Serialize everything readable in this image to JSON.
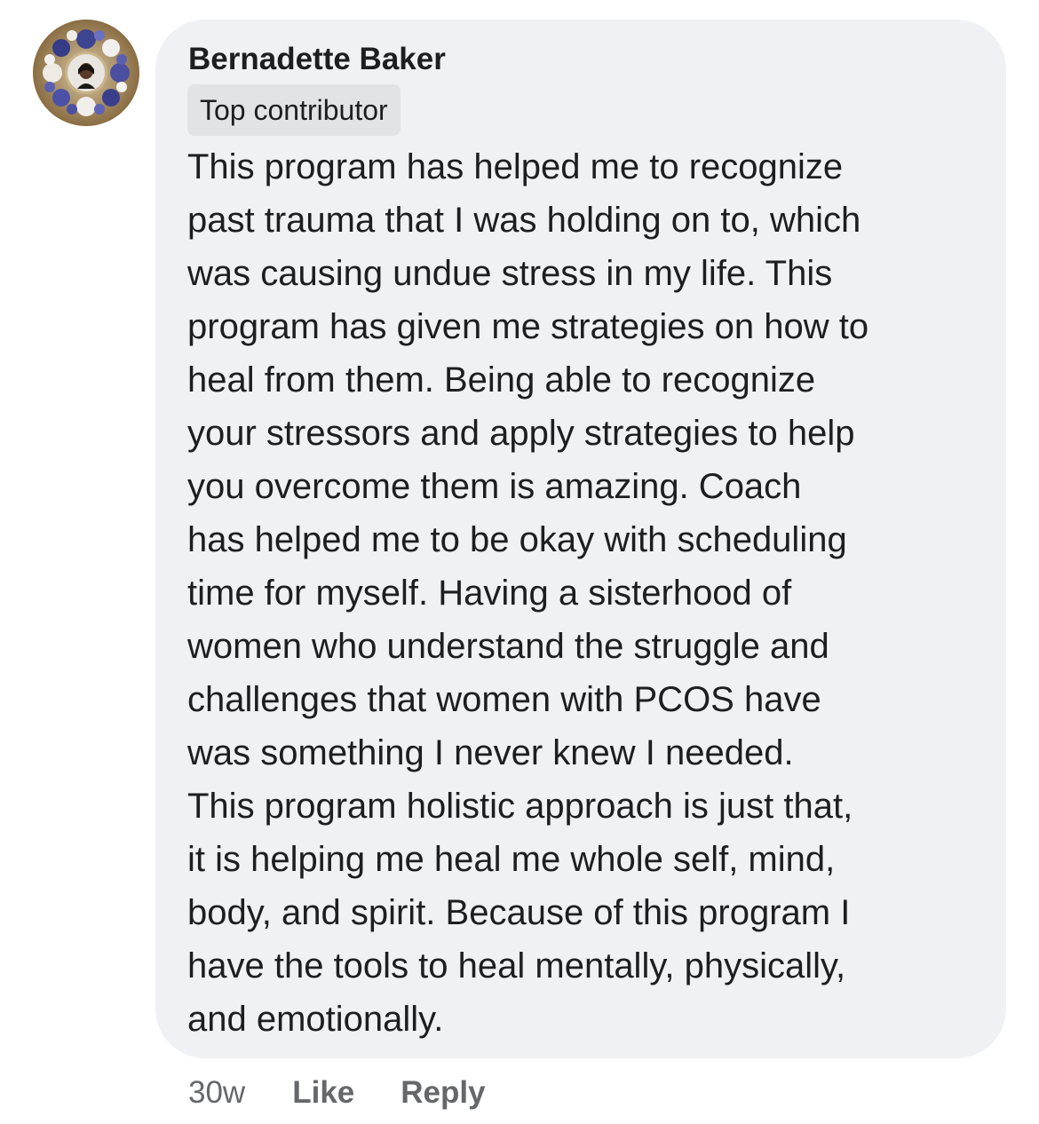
{
  "comment": {
    "author": "Bernadette Baker",
    "badge": "Top contributor",
    "text": "This program has helped me to recognize\npast trauma that I was holding on to, which\nwas causing undue stress in my life. This\nprogram has given me strategies on how to\nheal from them. Being able to recognize\nyour stressors and apply strategies to help\nyou overcome them is amazing.  Coach\nhas helped me to be okay with scheduling\ntime for myself. Having a sisterhood of\nwomen who understand the struggle and\nchallenges that women with PCOS have\nwas something I never knew I  needed.\nThis program holistic approach is just that,\nit is helping me heal me whole self, mind,\nbody, and spirit. Because of this program I\nhave the tools to heal mentally,  physically,\nand emotionally."
  },
  "actions": {
    "timestamp": "30w",
    "like_label": "Like",
    "reply_label": "Reply"
  },
  "colors": {
    "bubble_background": "#eff1f5",
    "badge_background": "#e1e3e7",
    "primary_text": "#1c1e21",
    "secondary_text": "#65676b"
  }
}
